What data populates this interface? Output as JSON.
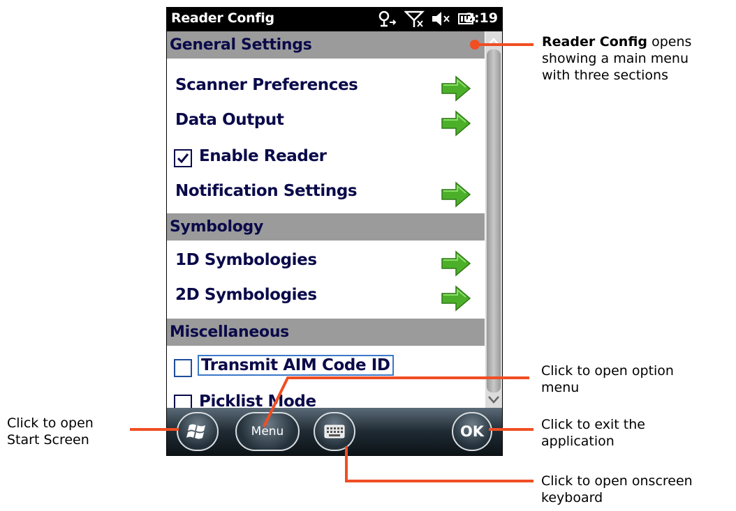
{
  "titlebar": {
    "title": "Reader Config",
    "time": "2:19"
  },
  "sections": [
    {
      "header": "General Settings"
    },
    {
      "header": "Symbology"
    },
    {
      "header": "Miscellaneous"
    }
  ],
  "general": {
    "scanner_preferences": "Scanner Preferences",
    "data_output": "Data Output",
    "enable_reader": "Enable Reader",
    "enable_reader_checked": true,
    "notification_settings": "Notification Settings"
  },
  "symbology": {
    "one_d": "1D Symbologies",
    "two_d": "2D Symbologies"
  },
  "misc": {
    "transmit_aim": "Transmit AIM Code ID",
    "transmit_aim_checked": false,
    "picklist": "Picklist Mode",
    "picklist_checked": false
  },
  "softbar": {
    "menu_label": "Menu",
    "ok_label": "OK"
  },
  "callouts": {
    "main_menu_bold": "Reader Config",
    "main_menu_line1_rest": " opens",
    "main_menu_line2": "showing a main menu",
    "main_menu_line3": "with three sections",
    "option_menu_line1": "Click to open option",
    "option_menu_line2": "menu",
    "start_line1": "Click to open",
    "start_line2": "Start Screen",
    "exit_line1": "Click to exit the",
    "exit_line2": "application",
    "keyboard_line1": "Click to open onscreen",
    "keyboard_line2": "keyboard"
  },
  "colors": {
    "accent": "#f04e23",
    "header_bg": "#9b9b9b",
    "text": "#0a0a4a",
    "arrow": "#4caf2a"
  }
}
